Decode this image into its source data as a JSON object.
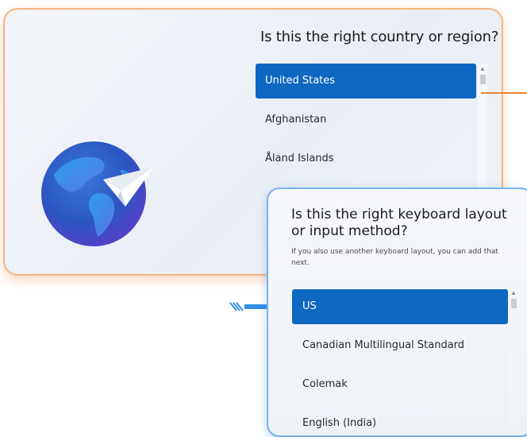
{
  "country": {
    "title": "Is this the right country or region?",
    "items": [
      {
        "label": "United States",
        "selected": true
      },
      {
        "label": "Afghanistan",
        "selected": false
      },
      {
        "label": "Åland Islands",
        "selected": false
      }
    ]
  },
  "keyboard": {
    "title": "Is this the right keyboard layout or input method?",
    "subtitle": "If you also use another keyboard layout, you can add that next.",
    "items": [
      {
        "label": "US",
        "selected": true
      },
      {
        "label": "Canadian Multilingual Standard",
        "selected": false
      },
      {
        "label": "Colemak",
        "selected": false
      },
      {
        "label": "English (India)",
        "selected": false
      }
    ]
  },
  "colors": {
    "accent": "#0e67c0",
    "country_border": "#f2b98a",
    "keyboard_border": "#7ab4ef",
    "arrow_orange": "#e8832d",
    "arrow_blue": "#2f8fe8"
  },
  "icons": {
    "globe": "globe-with-paper-plane-icon",
    "arrow_right": "orange-arrow-line",
    "arrow_pointer": "blue-arrow-icon"
  }
}
